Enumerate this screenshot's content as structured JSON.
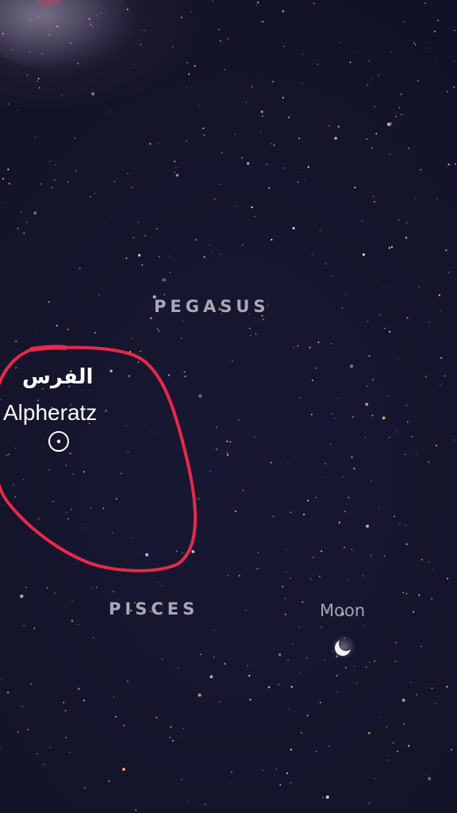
{
  "sky_view": {
    "constellations": {
      "pegasus": "PEGASUS",
      "pisces": "PISCES"
    },
    "moon": {
      "label": "Moon",
      "icon": "crescent-moon-icon"
    },
    "highlighted_star": {
      "arabic_name": "الفرس",
      "name": "Alpheratz",
      "icon": "star-target-icon"
    },
    "annotation_color": "#e8294a"
  }
}
